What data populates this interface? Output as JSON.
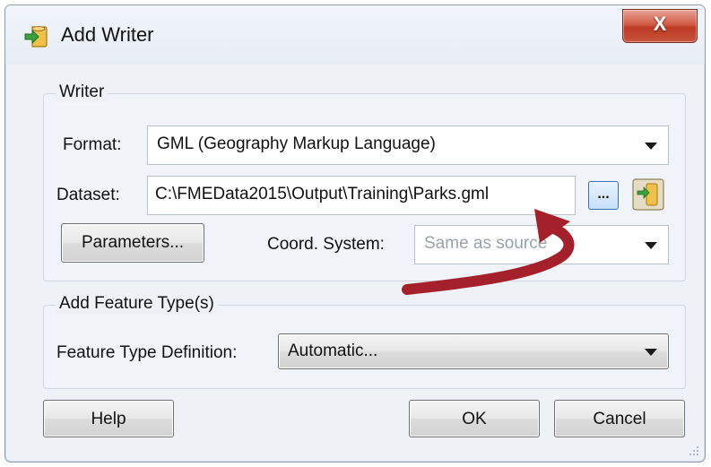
{
  "dialog": {
    "title": "Add Writer",
    "close_label": "X"
  },
  "writer_group": {
    "title": "Writer",
    "format_label": "Format:",
    "format_value": "GML (Geography Markup Language)",
    "dataset_label": "Dataset:",
    "dataset_value": "C:\\FMEData2015\\Output\\Training\\Parks.gml",
    "browse_label": "...",
    "parameters_label": "Parameters...",
    "coord_label": "Coord. System:",
    "coord_value": "Same as source"
  },
  "feature_group": {
    "title": "Add Feature Type(s)",
    "definition_label": "Feature Type Definition:",
    "definition_value": "Automatic..."
  },
  "buttons": {
    "help": "Help",
    "ok": "OK",
    "cancel": "Cancel"
  },
  "colors": {
    "annotation_arrow": "#a4202a",
    "close_button": "#c9533e"
  },
  "icons": {
    "app": "add-writer-icon",
    "close": "close-icon",
    "dataset_navigator": "dataset-navigator-icon",
    "dropdown": "chevron-down-icon"
  }
}
